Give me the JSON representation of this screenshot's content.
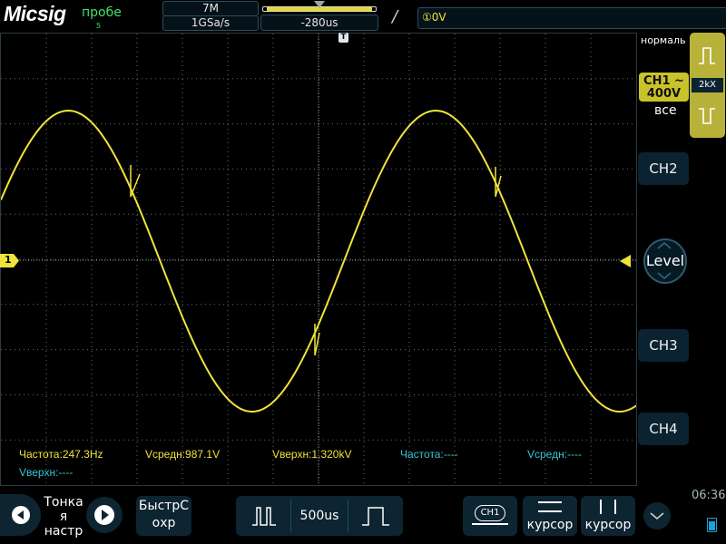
{
  "brand": {
    "logo": "Micsig",
    "probe_label": "пробе",
    "probe_sub": "5"
  },
  "timebase": {
    "memory": "7M",
    "sample_rate": "1GSa/s",
    "position": "-280us"
  },
  "trigger": {
    "slope_symbol": "/",
    "level_text": "①0V",
    "mode": "нормаль",
    "coupling": "2kX",
    "source_all": "все"
  },
  "channel1": {
    "name": "CH1",
    "coupling_symbol": "~",
    "scale": "400V",
    "marker": "1"
  },
  "side_buttons": {
    "ch2": "CH2",
    "level": "Level",
    "ch3": "CH3",
    "ch4": "CH4"
  },
  "measurements": [
    {
      "text": "Частота:247.3Hz",
      "color": "#f0e33a"
    },
    {
      "text": "Vсредн:987.1V",
      "color": "#f0e33a"
    },
    {
      "text": "Vверхн:1.320kV",
      "color": "#f0e33a"
    },
    {
      "text": "Частота:----",
      "color": "#36c4d6"
    },
    {
      "text": "Vсредн:----",
      "color": "#36c4d6"
    },
    {
      "text": "Vверхн:----",
      "color": "#36c4d6"
    }
  ],
  "bottom": {
    "menu_label_1": "Тонка",
    "menu_label_2": "я",
    "menu_label_3": "настр",
    "quick_save_1": "БыстрС",
    "quick_save_2": "охр",
    "time_scale": "500us",
    "ch1_tag": "CH1",
    "cursor1": "курсор",
    "cursor2": "курсор",
    "clock": "06:36"
  }
}
